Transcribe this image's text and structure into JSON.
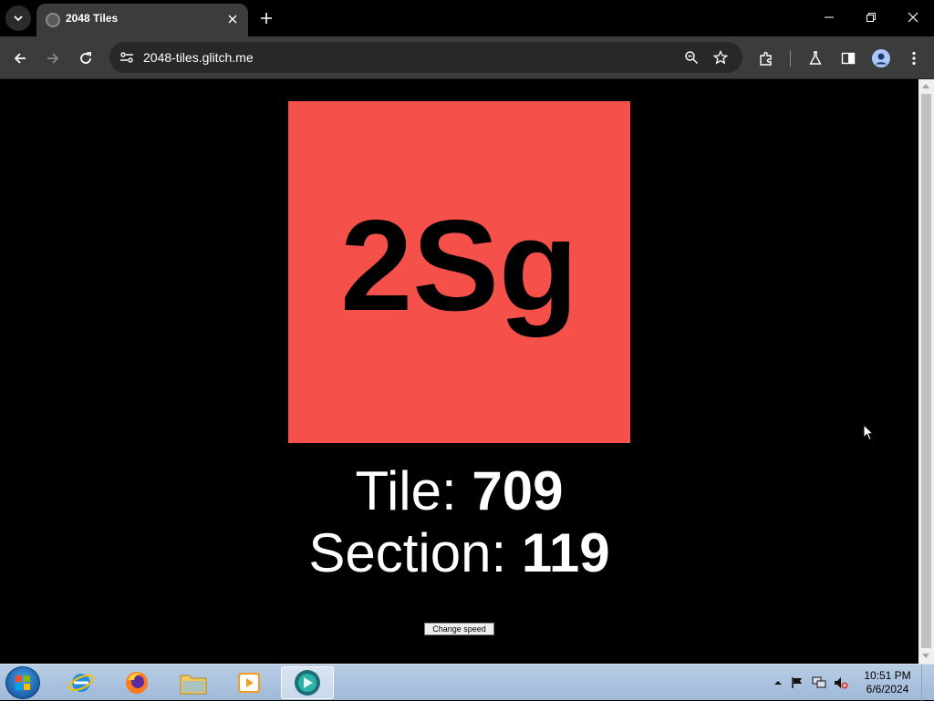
{
  "browser": {
    "tab": {
      "title": "2048 Tiles",
      "favicon": "globe-icon"
    },
    "url": "2048-tiles.glitch.me",
    "window_buttons": [
      "minimize-icon",
      "restore-icon",
      "close-icon"
    ],
    "toolbar_icons": [
      "back-icon",
      "forward-icon",
      "reload-icon",
      "site-info-icon",
      "zoom-icon",
      "star-icon",
      "extensions-icon",
      "labs-icon",
      "sidepanel-icon",
      "profile-icon",
      "menu-icon"
    ]
  },
  "page": {
    "tile": {
      "text": "2Sg",
      "color": "#f5514a"
    },
    "tile_label": "Tile:",
    "tile_value": "709",
    "section_label": "Section:",
    "section_value": "119",
    "button_label": "Change speed"
  },
  "taskbar": {
    "apps": [
      "internet-explorer-icon",
      "firefox-icon",
      "file-explorer-icon",
      "media-player-icon",
      "active-app-icon"
    ],
    "clock": {
      "time": "10:51 PM",
      "date": "6/6/2024"
    }
  }
}
